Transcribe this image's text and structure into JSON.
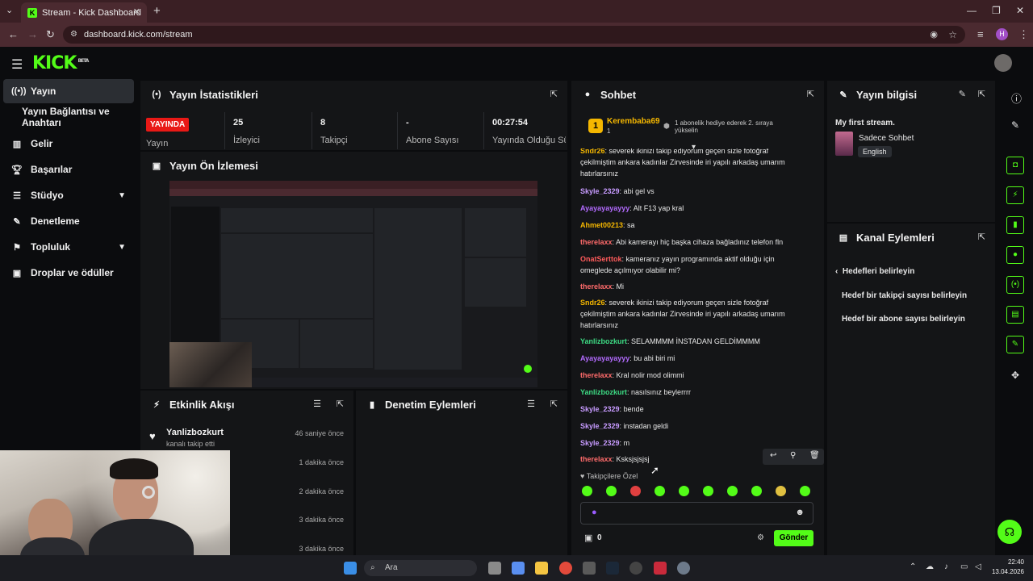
{
  "browser": {
    "tab_title": "Stream - Kick Dashboard",
    "url": "dashboard.kick.com/stream",
    "profile_initial": "H"
  },
  "header": {
    "logo": "KICK",
    "logo_sup": "BETA"
  },
  "sidebar": {
    "items": [
      {
        "label": "Yayın",
        "icon": "broadcast-icon",
        "active": true
      },
      {
        "label": "Yayın Bağlantısı ve Anahtarı",
        "icon": "",
        "active": false
      },
      {
        "label": "Gelir",
        "icon": "revenue-icon",
        "active": false
      },
      {
        "label": "Başarılar",
        "icon": "trophy-icon",
        "active": false
      },
      {
        "label": "Stüdyo",
        "icon": "studio-icon",
        "active": false
      },
      {
        "label": "Denetleme",
        "icon": "wrench-icon",
        "active": false
      },
      {
        "label": "Topluluk",
        "icon": "community-icon",
        "active": false
      },
      {
        "label": "Droplar ve ödüller",
        "icon": "gift-icon",
        "active": false
      }
    ]
  },
  "stats": {
    "title": "Yayın İstatistikleri",
    "live_badge": "YAYINDA",
    "live_label": "Yayın",
    "items": [
      {
        "value": "25",
        "label": "İzleyici"
      },
      {
        "value": "8",
        "label": "Takipçi"
      },
      {
        "value": "-",
        "label": "Abone Sayısı"
      },
      {
        "value": "00:27:54",
        "label": "Yayında Olduğu Süre"
      }
    ]
  },
  "preview": {
    "title": "Yayın Ön İzlemesi"
  },
  "activity": {
    "title": "Etkinlik Akışı",
    "rows": [
      {
        "name": "Yanlizbozkurt",
        "sub": "kanalı takip etti",
        "time": "46 saniye önce"
      },
      {
        "name": "",
        "sub": "",
        "time": "1 dakika önce"
      },
      {
        "name": "",
        "sub": "",
        "time": "2 dakika önce"
      },
      {
        "name": "",
        "sub": "",
        "time": "3 dakika önce"
      },
      {
        "name": "",
        "sub": "",
        "time": "3 dakika önce"
      }
    ]
  },
  "mod": {
    "title": "Denetim Eylemleri"
  },
  "chat": {
    "title": "Sohbet",
    "pinned_user": "Kerembaba69",
    "pinned_count": "1",
    "pinned_text": "1 abonelik hediye ederek 2. sıraya yükselin",
    "messages": [
      {
        "user": "Sndr26",
        "color": "#f5b700",
        "text": "severek ikinizi takip ediyorum geçen sizle fotoğraf çekilmiştim ankara kadınlar Zirvesinde iri yapılı arkadaş umarım hatırlarsınız"
      },
      {
        "user": "Skyle_2329",
        "color": "#c79bff",
        "text": "abi gel vs"
      },
      {
        "user": "Ayayayayayyy",
        "color": "#b36bff",
        "text": "Alt F13 yap kral"
      },
      {
        "user": "Ahmet00213",
        "color": "#f5b700",
        "text": "sa"
      },
      {
        "user": "therelaxx",
        "color": "#ff6b6b",
        "text": "Abi kamerayı hiç başka cihaza bağladınız telefon fln"
      },
      {
        "user": "OnatSerttok",
        "color": "#ff5b5b",
        "text": "kameranız yayın programında aktif olduğu için omeglede açılmıyor olabilir mi?"
      },
      {
        "user": "therelaxx",
        "color": "#ff6b6b",
        "text": "Mi"
      },
      {
        "user": "Sndr26",
        "color": "#f5b700",
        "text": "severek ikinizi takip ediyorum geçen sizle fotoğraf çekilmiştim ankara kadınlar Zirvesinde iri yapılı arkadaş umarım hatırlarsınız"
      },
      {
        "user": "Yanlizbozkurt",
        "color": "#3ddc84",
        "text": "SELAMMMM İNSTADAN GELDİMMMM"
      },
      {
        "user": "Ayayayayayyy",
        "color": "#b36bff",
        "text": "bu abi biri mi"
      },
      {
        "user": "therelaxx",
        "color": "#ff6b6b",
        "text": "Kral nolir mod olimmi"
      },
      {
        "user": "Yanlizbozkurt",
        "color": "#3ddc84",
        "text": "nasılsınız beylerrrr"
      },
      {
        "user": "Skyle_2329",
        "color": "#c79bff",
        "text": "bende"
      },
      {
        "user": "Skyle_2329",
        "color": "#c79bff",
        "text": "instadan geldi"
      },
      {
        "user": "Skyle_2329",
        "color": "#c79bff",
        "text": "m"
      },
      {
        "user": "therelaxx",
        "color": "#ff6b6b",
        "text": "Ksksjsjsjsj"
      }
    ],
    "followers_only": "Takipçilere Özel",
    "points": "0",
    "send_label": "Gönder"
  },
  "stream_info": {
    "title": "Yayın bilgisi",
    "stream_title": "My first stream.",
    "category": "Sadece Sohbet",
    "language": "English"
  },
  "channel_actions": {
    "title": "Kanal Eylemleri",
    "back_label": "Hedefleri belirleyin",
    "items": [
      "Hedef bir takipçi sayısı belirleyin",
      "Hedef bir abone sayısı belirleyin"
    ]
  },
  "taskbar": {
    "search": "Ara",
    "time": "22:40",
    "date": "13.04.2026"
  },
  "colors": {
    "accent": "#53fc18",
    "live": "#e91916",
    "panel": "#141517",
    "bg": "#0b0c0e"
  }
}
